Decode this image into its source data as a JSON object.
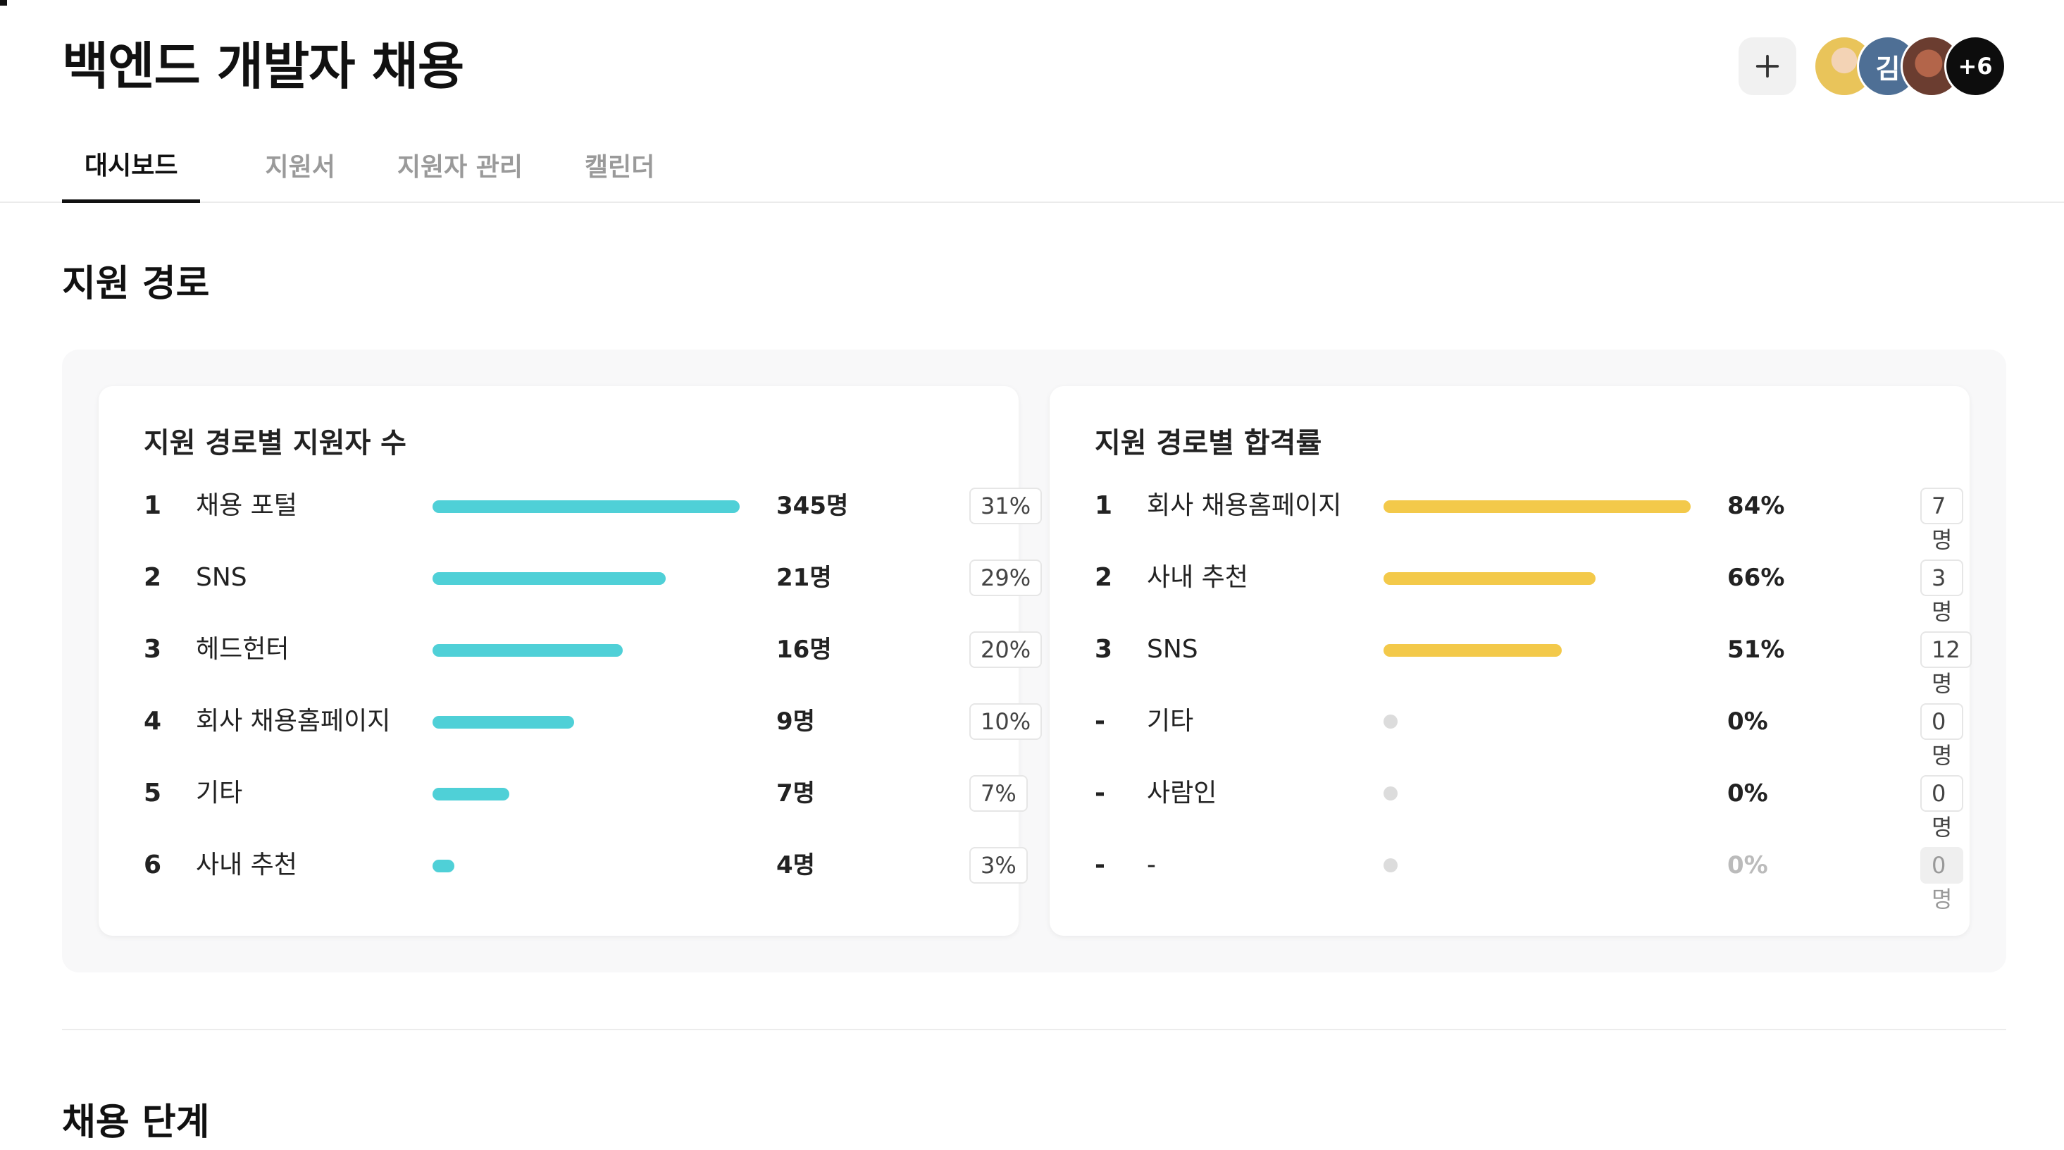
{
  "header": {
    "title": "백엔드 개발자 채용",
    "add_icon": "plus-icon",
    "avatars": [
      {
        "text": "",
        "kind": "photo"
      },
      {
        "text": "김",
        "kind": "initial",
        "color": "#4e6f95"
      },
      {
        "text": "",
        "kind": "photo"
      },
      {
        "text": "+6",
        "kind": "count",
        "color": "#0d0d0d"
      }
    ]
  },
  "tabs": [
    {
      "label": "대시보드",
      "active": true
    },
    {
      "label": "지원서",
      "active": false
    },
    {
      "label": "지원자 관리",
      "active": false
    },
    {
      "label": "캘린더",
      "active": false
    }
  ],
  "sections": {
    "source": "지원 경로",
    "stages": "채용 단계"
  },
  "applicants_by_source": {
    "title": "지원 경로별 지원자 수",
    "bar_color": "#4fd0d7",
    "rows": [
      {
        "rank": "1",
        "label": "채용 포털",
        "value": "345명",
        "chip": "31%",
        "bar_fraction": 1.0
      },
      {
        "rank": "2",
        "label": "SNS",
        "value": "21명",
        "chip": "29%",
        "bar_fraction": 0.76
      },
      {
        "rank": "3",
        "label": "헤드헌터",
        "value": "16명",
        "chip": "20%",
        "bar_fraction": 0.62
      },
      {
        "rank": "4",
        "label": "회사 채용홈페이지",
        "value": "9명",
        "chip": "10%",
        "bar_fraction": 0.46
      },
      {
        "rank": "5",
        "label": "기타",
        "value": "7명",
        "chip": "7%",
        "bar_fraction": 0.25
      },
      {
        "rank": "6",
        "label": "사내 추천",
        "value": "4명",
        "chip": "3%",
        "bar_fraction": 0.07
      }
    ]
  },
  "pass_rate_by_source": {
    "title": "지원 경로별 합격률",
    "bar_color": "#f3c94a",
    "rows": [
      {
        "rank": "1",
        "label": "회사 채용홈페이지",
        "value": "84%",
        "chip": "7명",
        "bar_fraction": 1.0,
        "muted": false
      },
      {
        "rank": "2",
        "label": "사내 추천",
        "value": "66%",
        "chip": "3명",
        "bar_fraction": 0.69,
        "muted": false
      },
      {
        "rank": "3",
        "label": "SNS",
        "value": "51%",
        "chip": "12명",
        "bar_fraction": 0.58,
        "muted": false
      },
      {
        "rank": "-",
        "label": "기타",
        "value": "0%",
        "chip": "0명",
        "bar_fraction": 0,
        "muted": false
      },
      {
        "rank": "-",
        "label": "사람인",
        "value": "0%",
        "chip": "0명",
        "bar_fraction": 0,
        "muted": false
      },
      {
        "rank": "-",
        "label": "-",
        "value": "0%",
        "chip": "0명",
        "bar_fraction": 0,
        "muted": true
      }
    ]
  }
}
